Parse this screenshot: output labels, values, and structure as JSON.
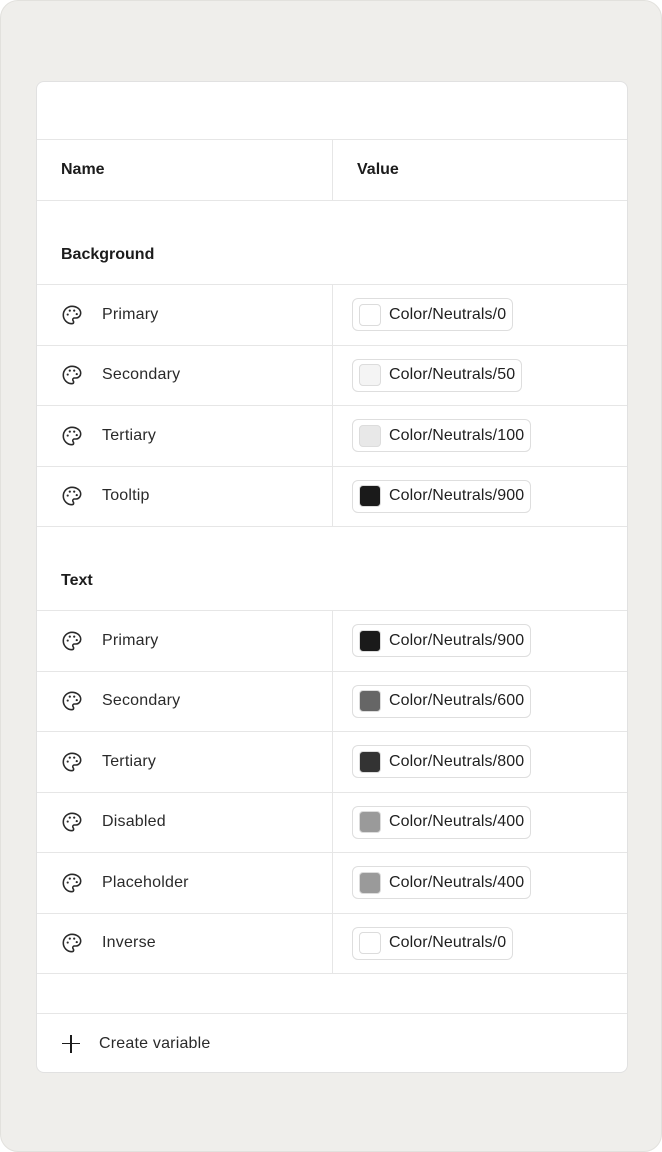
{
  "table": {
    "header": {
      "name": "Name",
      "value": "Value"
    },
    "groups": [
      {
        "title": "Background",
        "rows": [
          {
            "icon": "palette-icon",
            "name": "Primary",
            "value": "Color/Neutrals/0",
            "swatch": "#ffffff"
          },
          {
            "icon": "palette-icon",
            "name": "Secondary",
            "value": "Color/Neutrals/50",
            "swatch": "#f4f4f4"
          },
          {
            "icon": "palette-icon",
            "name": "Tertiary",
            "value": "Color/Neutrals/100",
            "swatch": "#e8e8e8"
          },
          {
            "icon": "palette-icon",
            "name": "Tooltip",
            "value": "Color/Neutrals/900",
            "swatch": "#1a1a1a"
          }
        ]
      },
      {
        "title": "Text",
        "rows": [
          {
            "icon": "palette-icon",
            "name": "Primary",
            "value": "Color/Neutrals/900",
            "swatch": "#1a1a1a"
          },
          {
            "icon": "palette-icon",
            "name": "Secondary",
            "value": "Color/Neutrals/600",
            "swatch": "#666666"
          },
          {
            "icon": "palette-icon",
            "name": "Tertiary",
            "value": "Color/Neutrals/800",
            "swatch": "#333333"
          },
          {
            "icon": "palette-icon",
            "name": "Disabled",
            "value": "Color/Neutrals/400",
            "swatch": "#9a9a9a"
          },
          {
            "icon": "palette-icon",
            "name": "Placeholder",
            "value": "Color/Neutrals/400",
            "swatch": "#9a9a9a"
          },
          {
            "icon": "palette-icon",
            "name": "Inverse",
            "value": "Color/Neutrals/0",
            "swatch": "#ffffff"
          }
        ]
      }
    ]
  },
  "footer": {
    "icon": "plus-icon",
    "create_label": "Create variable"
  }
}
